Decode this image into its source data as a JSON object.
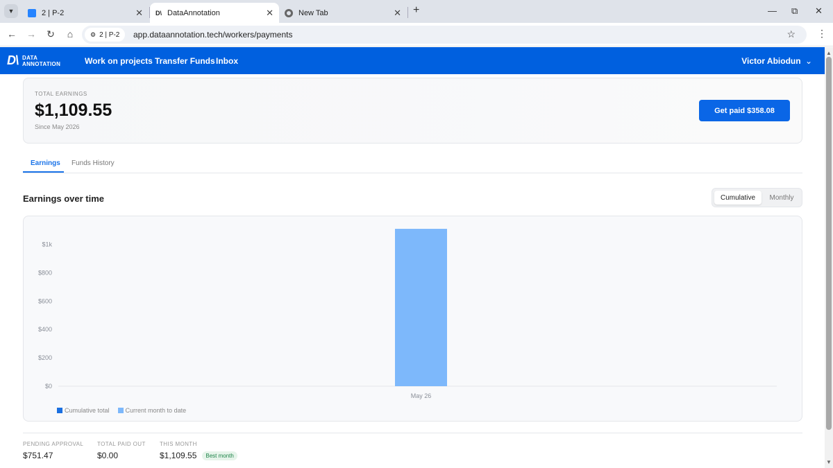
{
  "browser": {
    "tabs": [
      {
        "title": "2 | P-2",
        "favicon": "jira-icon"
      },
      {
        "title": "DataAnnotation",
        "favicon": "dataannotation-icon"
      },
      {
        "title": "New Tab",
        "favicon": "chrome-icon"
      }
    ],
    "site_chip": "2 | P-2",
    "url": "app.dataannotation.tech/workers/payments"
  },
  "header": {
    "logo_line1": "DATA",
    "logo_line2": "ANNOTATION",
    "nav": [
      "Work on projects",
      "Transfer Funds",
      "Inbox"
    ],
    "user": "Victor Abiodun"
  },
  "earnings": {
    "label": "TOTAL EARNINGS",
    "amount": "$1,109.55",
    "since": "Since May 2026",
    "get_paid_label": "Get paid $358.08"
  },
  "tabs": {
    "earnings": "Earnings",
    "funds_history": "Funds History"
  },
  "section": {
    "title": "Earnings over time",
    "toggle_cumulative": "Cumulative",
    "toggle_monthly": "Monthly"
  },
  "chart_data": {
    "type": "bar",
    "categories": [
      "May 26"
    ],
    "series": [
      {
        "name": "Cumulative total",
        "values": [
          0
        ]
      },
      {
        "name": "Current month to date",
        "values": [
          1109.55
        ]
      }
    ],
    "ylim": [
      0,
      1100
    ],
    "yticks": [
      0,
      200,
      400,
      600,
      800,
      1000
    ],
    "ytick_labels": [
      "$0",
      "$200",
      "$400",
      "$600",
      "$800",
      "$1k"
    ],
    "grid": false,
    "legend_position": "bottom-left",
    "colors": {
      "cumulative": "#1a6fe0",
      "current": "#7db8fb"
    }
  },
  "stats": [
    {
      "label": "PENDING APPROVAL",
      "value": "$751.47"
    },
    {
      "label": "TOTAL PAID OUT",
      "value": "$0.00"
    },
    {
      "label": "THIS MONTH",
      "value": "$1,109.55",
      "badge": "Best month"
    }
  ],
  "colors": {
    "brand": "#0060df",
    "button": "#0a66e6",
    "accent": "#1a73e8"
  }
}
